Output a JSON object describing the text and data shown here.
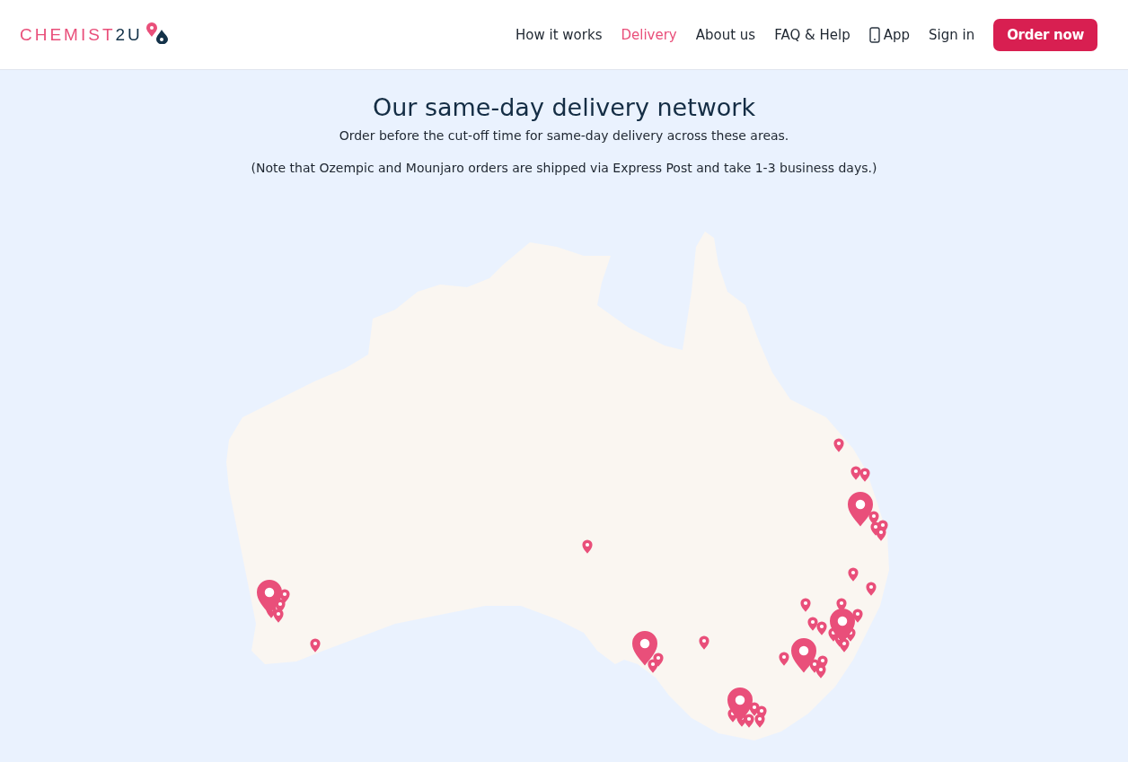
{
  "logo": {
    "part_1": "CHEMIST",
    "part_2": "2U"
  },
  "nav": [
    {
      "label": "How it works",
      "kind": "link",
      "selected": false
    },
    {
      "label": "Delivery",
      "kind": "link",
      "selected": true
    },
    {
      "label": "About us",
      "kind": "link",
      "selected": false
    },
    {
      "label": "FAQ & Help",
      "kind": "link",
      "selected": false
    },
    {
      "label": "App",
      "kind": "app",
      "selected": false
    },
    {
      "label": "Sign in",
      "kind": "link",
      "selected": false
    }
  ],
  "cta": "Order now",
  "heading": "Our same-day delivery network",
  "subheading": "Order before the cut-off time for same-day delivery across these areas.",
  "note": "(Note that Ozempic and Mounjaro orders are shipped via Express Post and take 1-3 business days.)"
}
